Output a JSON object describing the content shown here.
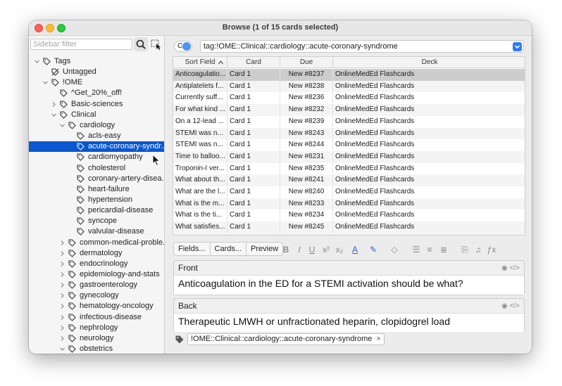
{
  "window": {
    "title": "Browse (1 of 15 cards selected)"
  },
  "sidebar": {
    "filter_placeholder": "Sidebar filter",
    "tree": [
      {
        "label": "Tags",
        "level": 0,
        "expanded": true,
        "icon": "tag-icon"
      },
      {
        "label": "Untagged",
        "level": 1,
        "icon": "untagged-icon"
      },
      {
        "label": "!OME",
        "level": 1,
        "expanded": true,
        "icon": "tag-icon"
      },
      {
        "label": "^Get_20%_off!",
        "level": 2,
        "icon": "tag-icon"
      },
      {
        "label": "Basic-sciences",
        "level": 2,
        "collapsed": true,
        "icon": "tag-icon"
      },
      {
        "label": "Clinical",
        "level": 2,
        "expanded": true,
        "icon": "tag-icon"
      },
      {
        "label": "cardiology",
        "level": 3,
        "expanded": true,
        "icon": "tag-icon"
      },
      {
        "label": "acls-easy",
        "level": 4,
        "icon": "tag-icon"
      },
      {
        "label": "acute-coronary-syndr...",
        "level": 4,
        "selected": true,
        "icon": "tag-icon"
      },
      {
        "label": "cardiomyopathy",
        "level": 4,
        "icon": "tag-icon"
      },
      {
        "label": "cholesterol",
        "level": 4,
        "icon": "tag-icon"
      },
      {
        "label": "coronary-artery-disea...",
        "level": 4,
        "icon": "tag-icon"
      },
      {
        "label": "heart-failure",
        "level": 4,
        "icon": "tag-icon"
      },
      {
        "label": "hypertension",
        "level": 4,
        "icon": "tag-icon"
      },
      {
        "label": "pericardial-disease",
        "level": 4,
        "icon": "tag-icon"
      },
      {
        "label": "syncope",
        "level": 4,
        "icon": "tag-icon"
      },
      {
        "label": "valvular-disease",
        "level": 4,
        "icon": "tag-icon"
      },
      {
        "label": "common-medical-proble...",
        "level": 3,
        "collapsed": true,
        "icon": "tag-icon"
      },
      {
        "label": "dermatology",
        "level": 3,
        "collapsed": true,
        "icon": "tag-icon"
      },
      {
        "label": "endocrinology",
        "level": 3,
        "collapsed": true,
        "icon": "tag-icon"
      },
      {
        "label": "epidemiology-and-stats",
        "level": 3,
        "collapsed": true,
        "icon": "tag-icon"
      },
      {
        "label": "gastroenterology",
        "level": 3,
        "collapsed": true,
        "icon": "tag-icon"
      },
      {
        "label": "gynecology",
        "level": 3,
        "collapsed": true,
        "icon": "tag-icon"
      },
      {
        "label": "hematology-oncology",
        "level": 3,
        "collapsed": true,
        "icon": "tag-icon"
      },
      {
        "label": "infectious-disease",
        "level": 3,
        "collapsed": true,
        "icon": "tag-icon"
      },
      {
        "label": "nephrology",
        "level": 3,
        "collapsed": true,
        "icon": "tag-icon"
      },
      {
        "label": "neurology",
        "level": 3,
        "collapsed": true,
        "icon": "tag-icon"
      },
      {
        "label": "obstetrics",
        "level": 3,
        "expanded": true,
        "icon": "tag-icon"
      }
    ]
  },
  "search": {
    "toggle_label": "C",
    "query": "tag:!OME::Clinical::cardiology::acute-coronary-syndrome"
  },
  "table": {
    "columns": [
      "Sort Field",
      "Card",
      "Due",
      "Deck"
    ],
    "rows": [
      {
        "sort": "Anticoagulatio...",
        "card": "Card 1",
        "due": "New #8237",
        "deck": "OnlineMedEd Flashcards",
        "selected": true
      },
      {
        "sort": "Antiplatelets f...",
        "card": "Card 1",
        "due": "New #8238",
        "deck": "OnlineMedEd Flashcards"
      },
      {
        "sort": "Currently suff...",
        "card": "Card 1",
        "due": "New #8236",
        "deck": "OnlineMedEd Flashcards"
      },
      {
        "sort": "For what kind ...",
        "card": "Card 1",
        "due": "New #8232",
        "deck": "OnlineMedEd Flashcards"
      },
      {
        "sort": "On a 12-lead ...",
        "card": "Card 1",
        "due": "New #8239",
        "deck": "OnlineMedEd Flashcards"
      },
      {
        "sort": "STEMI was n...",
        "card": "Card 1",
        "due": "New #8243",
        "deck": "OnlineMedEd Flashcards"
      },
      {
        "sort": "STEMI was n...",
        "card": "Card 1",
        "due": "New #8244",
        "deck": "OnlineMedEd Flashcards"
      },
      {
        "sort": "Time to balloo...",
        "card": "Card 1",
        "due": "New #8231",
        "deck": "OnlineMedEd Flashcards"
      },
      {
        "sort": "Troponin-I ver...",
        "card": "Card 1",
        "due": "New #8235",
        "deck": "OnlineMedEd Flashcards"
      },
      {
        "sort": "What about th...",
        "card": "Card 1",
        "due": "New #8241",
        "deck": "OnlineMedEd Flashcards"
      },
      {
        "sort": "What are the l...",
        "card": "Card 1",
        "due": "New #8240",
        "deck": "OnlineMedEd Flashcards"
      },
      {
        "sort": "What is the m...",
        "card": "Card 1",
        "due": "New #8233",
        "deck": "OnlineMedEd Flashcards"
      },
      {
        "sort": "What is the ti...",
        "card": "Card 1",
        "due": "New #8234",
        "deck": "OnlineMedEd Flashcards"
      },
      {
        "sort": "What satisfies...",
        "card": "Card 1",
        "due": "New #8245",
        "deck": "OnlineMedEd Flashcards"
      }
    ]
  },
  "editor": {
    "fields_btn": "Fields...",
    "cards_btn": "Cards...",
    "preview_btn": "Preview",
    "format_icons": [
      "bold-icon",
      "italic-icon",
      "underline-icon",
      "superscript-icon",
      "subscript-icon",
      "text-color-icon",
      "highlight-icon",
      "eraser-icon",
      "bullet-list-icon",
      "numbered-list-icon",
      "align-icon",
      "attach-icon",
      "record-audio-icon",
      "formula-icon"
    ],
    "fields": [
      {
        "name": "Front",
        "value": "Anticoagulation in the ED for a STEMI activation should be what?"
      },
      {
        "name": "Back",
        "value": "Therapeutic LMWH or unfractionated heparin, clopidogrel load"
      }
    ],
    "tag": "!OME::Clinical::cardiology::acute-coronary-syndrome",
    "tag_remove": "×"
  }
}
